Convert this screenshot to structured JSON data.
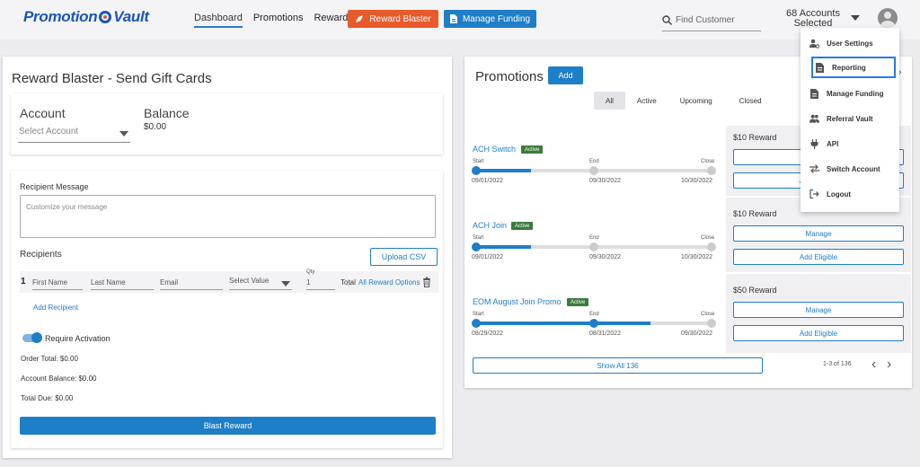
{
  "brand": {
    "logo_left": "Promotion",
    "logo_right": "Vault"
  },
  "nav": {
    "dashboard": "Dashboard",
    "promotions": "Promotions",
    "rewards": "Rewards",
    "reward_blaster": "Reward Blaster",
    "manage_funding": "Manage Funding"
  },
  "header": {
    "search_placeholder": "Find Customer",
    "accounts_line1": "68 Accounts",
    "accounts_line2": "Selected"
  },
  "user_menu": {
    "items": [
      {
        "label": "User Settings",
        "icon": "user-settings-icon"
      },
      {
        "label": "Reporting",
        "icon": "report-icon"
      },
      {
        "label": "Manage Funding",
        "icon": "document-icon"
      },
      {
        "label": "Referral Vault",
        "icon": "users-icon"
      },
      {
        "label": "API",
        "icon": "plug-icon"
      },
      {
        "label": "Switch Account",
        "icon": "swap-icon"
      },
      {
        "label": "Logout",
        "icon": "logout-icon"
      }
    ]
  },
  "blaster": {
    "title": "Reward Blaster - Send Gift Cards",
    "account_label": "Account",
    "account_placeholder": "Select Account",
    "balance_label": "Balance",
    "balance_value": "$0.00",
    "recipient_message_label": "Recipient Message",
    "recipient_message_placeholder": "Customize your message",
    "recipients_label": "Recipients",
    "upload_csv": "Upload CSV",
    "row": {
      "number": "1",
      "first_name": "First Name",
      "last_name": "Last Name",
      "email": "Email",
      "select_value": "Select Value",
      "qty_label": "Qty",
      "qty_value": "1",
      "total": "Total",
      "all_options": "All Reward Options"
    },
    "add_recipient": "Add Recipient",
    "require_activation": "Require Activation",
    "order_total": "Order Total: $0.00",
    "account_balance": "Account Balance: $0.00",
    "total_due": "Total Due: $0.00",
    "blast_button": "Blast Reward"
  },
  "promotions": {
    "title": "Promotions",
    "add_button": "Add",
    "filters": [
      "All",
      "Active",
      "Upcoming",
      "Closed"
    ],
    "timeline_labels": {
      "start": "Start",
      "end": "End",
      "close": "Close"
    },
    "items": [
      {
        "name": "ACH Switch",
        "status": "Active",
        "start": "09/01/2022",
        "end": "09/30/2022",
        "close": "10/30/2022",
        "progress": 0.23,
        "reward": "$10 Reward"
      },
      {
        "name": "ACH Join",
        "status": "Active",
        "start": "09/01/2022",
        "end": "09/30/2022",
        "close": "10/30/2022",
        "progress": 0.23,
        "reward": "$10 Reward"
      },
      {
        "name": "EOM August Join Promo",
        "status": "Active",
        "start": "08/29/2022",
        "end": "08/31/2022",
        "close": "09/30/2022",
        "progress": 0.73,
        "reward": "$50 Reward"
      }
    ],
    "manage_label": "Manage",
    "add_eligible_label": "Add Eligible",
    "show_all": "Show All 136",
    "pager_text": "1-3 of 136"
  }
}
